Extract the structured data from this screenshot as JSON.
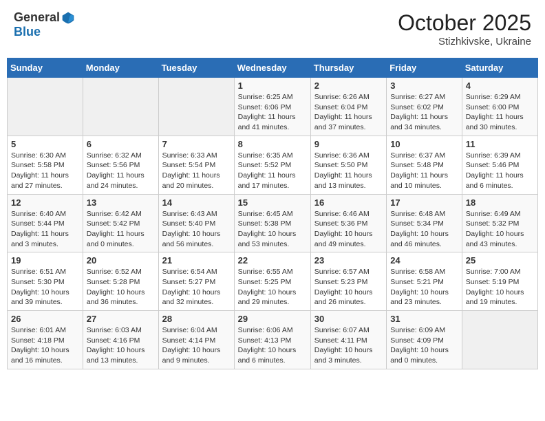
{
  "header": {
    "logo_general": "General",
    "logo_blue": "Blue",
    "month": "October 2025",
    "location": "Stizhkivske, Ukraine"
  },
  "weekdays": [
    "Sunday",
    "Monday",
    "Tuesday",
    "Wednesday",
    "Thursday",
    "Friday",
    "Saturday"
  ],
  "weeks": [
    [
      {
        "day": "",
        "sunrise": "",
        "sunset": "",
        "daylight": ""
      },
      {
        "day": "",
        "sunrise": "",
        "sunset": "",
        "daylight": ""
      },
      {
        "day": "",
        "sunrise": "",
        "sunset": "",
        "daylight": ""
      },
      {
        "day": "1",
        "sunrise": "Sunrise: 6:25 AM",
        "sunset": "Sunset: 6:06 PM",
        "daylight": "Daylight: 11 hours and 41 minutes."
      },
      {
        "day": "2",
        "sunrise": "Sunrise: 6:26 AM",
        "sunset": "Sunset: 6:04 PM",
        "daylight": "Daylight: 11 hours and 37 minutes."
      },
      {
        "day": "3",
        "sunrise": "Sunrise: 6:27 AM",
        "sunset": "Sunset: 6:02 PM",
        "daylight": "Daylight: 11 hours and 34 minutes."
      },
      {
        "day": "4",
        "sunrise": "Sunrise: 6:29 AM",
        "sunset": "Sunset: 6:00 PM",
        "daylight": "Daylight: 11 hours and 30 minutes."
      }
    ],
    [
      {
        "day": "5",
        "sunrise": "Sunrise: 6:30 AM",
        "sunset": "Sunset: 5:58 PM",
        "daylight": "Daylight: 11 hours and 27 minutes."
      },
      {
        "day": "6",
        "sunrise": "Sunrise: 6:32 AM",
        "sunset": "Sunset: 5:56 PM",
        "daylight": "Daylight: 11 hours and 24 minutes."
      },
      {
        "day": "7",
        "sunrise": "Sunrise: 6:33 AM",
        "sunset": "Sunset: 5:54 PM",
        "daylight": "Daylight: 11 hours and 20 minutes."
      },
      {
        "day": "8",
        "sunrise": "Sunrise: 6:35 AM",
        "sunset": "Sunset: 5:52 PM",
        "daylight": "Daylight: 11 hours and 17 minutes."
      },
      {
        "day": "9",
        "sunrise": "Sunrise: 6:36 AM",
        "sunset": "Sunset: 5:50 PM",
        "daylight": "Daylight: 11 hours and 13 minutes."
      },
      {
        "day": "10",
        "sunrise": "Sunrise: 6:37 AM",
        "sunset": "Sunset: 5:48 PM",
        "daylight": "Daylight: 11 hours and 10 minutes."
      },
      {
        "day": "11",
        "sunrise": "Sunrise: 6:39 AM",
        "sunset": "Sunset: 5:46 PM",
        "daylight": "Daylight: 11 hours and 6 minutes."
      }
    ],
    [
      {
        "day": "12",
        "sunrise": "Sunrise: 6:40 AM",
        "sunset": "Sunset: 5:44 PM",
        "daylight": "Daylight: 11 hours and 3 minutes."
      },
      {
        "day": "13",
        "sunrise": "Sunrise: 6:42 AM",
        "sunset": "Sunset: 5:42 PM",
        "daylight": "Daylight: 11 hours and 0 minutes."
      },
      {
        "day": "14",
        "sunrise": "Sunrise: 6:43 AM",
        "sunset": "Sunset: 5:40 PM",
        "daylight": "Daylight: 10 hours and 56 minutes."
      },
      {
        "day": "15",
        "sunrise": "Sunrise: 6:45 AM",
        "sunset": "Sunset: 5:38 PM",
        "daylight": "Daylight: 10 hours and 53 minutes."
      },
      {
        "day": "16",
        "sunrise": "Sunrise: 6:46 AM",
        "sunset": "Sunset: 5:36 PM",
        "daylight": "Daylight: 10 hours and 49 minutes."
      },
      {
        "day": "17",
        "sunrise": "Sunrise: 6:48 AM",
        "sunset": "Sunset: 5:34 PM",
        "daylight": "Daylight: 10 hours and 46 minutes."
      },
      {
        "day": "18",
        "sunrise": "Sunrise: 6:49 AM",
        "sunset": "Sunset: 5:32 PM",
        "daylight": "Daylight: 10 hours and 43 minutes."
      }
    ],
    [
      {
        "day": "19",
        "sunrise": "Sunrise: 6:51 AM",
        "sunset": "Sunset: 5:30 PM",
        "daylight": "Daylight: 10 hours and 39 minutes."
      },
      {
        "day": "20",
        "sunrise": "Sunrise: 6:52 AM",
        "sunset": "Sunset: 5:28 PM",
        "daylight": "Daylight: 10 hours and 36 minutes."
      },
      {
        "day": "21",
        "sunrise": "Sunrise: 6:54 AM",
        "sunset": "Sunset: 5:27 PM",
        "daylight": "Daylight: 10 hours and 32 minutes."
      },
      {
        "day": "22",
        "sunrise": "Sunrise: 6:55 AM",
        "sunset": "Sunset: 5:25 PM",
        "daylight": "Daylight: 10 hours and 29 minutes."
      },
      {
        "day": "23",
        "sunrise": "Sunrise: 6:57 AM",
        "sunset": "Sunset: 5:23 PM",
        "daylight": "Daylight: 10 hours and 26 minutes."
      },
      {
        "day": "24",
        "sunrise": "Sunrise: 6:58 AM",
        "sunset": "Sunset: 5:21 PM",
        "daylight": "Daylight: 10 hours and 23 minutes."
      },
      {
        "day": "25",
        "sunrise": "Sunrise: 7:00 AM",
        "sunset": "Sunset: 5:19 PM",
        "daylight": "Daylight: 10 hours and 19 minutes."
      }
    ],
    [
      {
        "day": "26",
        "sunrise": "Sunrise: 6:01 AM",
        "sunset": "Sunset: 4:18 PM",
        "daylight": "Daylight: 10 hours and 16 minutes."
      },
      {
        "day": "27",
        "sunrise": "Sunrise: 6:03 AM",
        "sunset": "Sunset: 4:16 PM",
        "daylight": "Daylight: 10 hours and 13 minutes."
      },
      {
        "day": "28",
        "sunrise": "Sunrise: 6:04 AM",
        "sunset": "Sunset: 4:14 PM",
        "daylight": "Daylight: 10 hours and 9 minutes."
      },
      {
        "day": "29",
        "sunrise": "Sunrise: 6:06 AM",
        "sunset": "Sunset: 4:13 PM",
        "daylight": "Daylight: 10 hours and 6 minutes."
      },
      {
        "day": "30",
        "sunrise": "Sunrise: 6:07 AM",
        "sunset": "Sunset: 4:11 PM",
        "daylight": "Daylight: 10 hours and 3 minutes."
      },
      {
        "day": "31",
        "sunrise": "Sunrise: 6:09 AM",
        "sunset": "Sunset: 4:09 PM",
        "daylight": "Daylight: 10 hours and 0 minutes."
      },
      {
        "day": "",
        "sunrise": "",
        "sunset": "",
        "daylight": ""
      }
    ]
  ]
}
